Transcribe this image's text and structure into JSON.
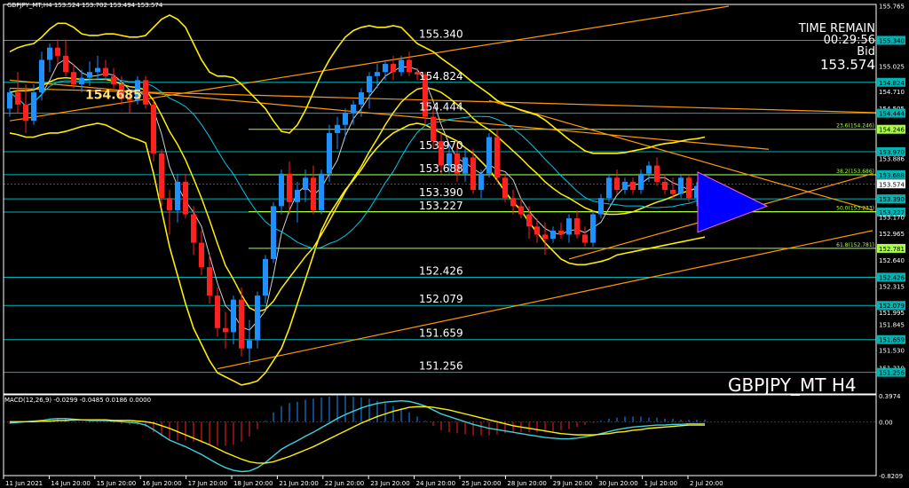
{
  "header": {
    "main_info": "GBPJPY_MT,H4  153.524 153.702 153.494 153.574",
    "macd_info": "MACD(12,26,9) -0.0299 -0.0485 0.0186 0.0000"
  },
  "info_panel": {
    "time_remain_label": "TIME REMAIN",
    "time_remain_value": "00:29:56",
    "bid_label": "Bid",
    "bid_value": "153.574"
  },
  "symbol_watermark": "GBPJPY_MT H4",
  "colors": {
    "background": "#000000",
    "bull_candle": "#1e90ff",
    "bear_candle": "#ff2020",
    "level_line": "#00b4b4",
    "fib_line": "#a8ff40",
    "bollinger": "#ffee00",
    "trend_line": "#ff9900",
    "ma_fast": "#d0d0d0",
    "ma_slow": "#00c8e8",
    "triangle": "#0000ff"
  },
  "chart_data": [
    {
      "type": "candlestick",
      "title": "GBPJPY_MT,H4",
      "ylim": [
        150.99,
        155.76
      ],
      "x_tick_labels": [
        "11 Jun 2021",
        "14 Jun 20:00",
        "15 Jun 20:00",
        "16 Jun 20:00",
        "17 Jun 20:00",
        "18 Jun 20:00",
        "21 Jun 20:00",
        "22 Jun 20:00",
        "23 Jun 20:00",
        "24 Jun 20:00",
        "25 Jun 20:00",
        "28 Jun 20:00",
        "29 Jun 20:00",
        "30 Jun 20:00",
        "1 Jul 20:00",
        "2 Jul 20:00"
      ],
      "y_tick_labels": [
        "155.765",
        "155.340",
        "155.025",
        "154.824",
        "154.710",
        "154.505",
        "154.444",
        "154.246",
        "153.970",
        "153.886",
        "153.688",
        "153.574",
        "153.390",
        "153.227",
        "153.170",
        "152.965",
        "152.781",
        "152.640",
        "152.426",
        "152.315",
        "152.079",
        "151.995",
        "151.845",
        "151.659",
        "151.530",
        "151.310",
        "151.256"
      ],
      "levels": [
        {
          "label": "155.340",
          "value": 155.34
        },
        {
          "label": "154.824",
          "value": 154.824
        },
        {
          "label": "154.444",
          "value": 154.444
        },
        {
          "label": "153.970",
          "value": 153.97
        },
        {
          "label": "153.688",
          "value": 153.688
        },
        {
          "label": "153.390",
          "value": 153.39
        },
        {
          "label": "153.227",
          "value": 153.227
        },
        {
          "label": "152.426",
          "value": 152.426
        },
        {
          "label": "152.079",
          "value": 152.079
        },
        {
          "label": "151.659",
          "value": 151.659
        },
        {
          "label": "151.256",
          "value": 151.256
        }
      ],
      "fib_labels": [
        {
          "label": "23.6(154.246)",
          "value": 154.246
        },
        {
          "label": "38.2(153.686)",
          "value": 153.686
        },
        {
          "label": "50.0(153.233)",
          "value": 153.233
        },
        {
          "label": "61.8(152.781)",
          "value": 152.781
        }
      ],
      "annotation": {
        "label": "154.685",
        "value": 154.685
      },
      "current_price": 153.574,
      "ohlc": [
        [
          154.5,
          154.75,
          154.4,
          154.7
        ],
        [
          154.7,
          154.95,
          154.45,
          154.55
        ],
        [
          154.55,
          154.8,
          154.2,
          154.35
        ],
        [
          154.35,
          154.8,
          154.3,
          154.7
        ],
        [
          154.7,
          155.2,
          154.6,
          155.1
        ],
        [
          155.1,
          155.3,
          154.95,
          155.25
        ],
        [
          155.25,
          155.35,
          155.05,
          155.15
        ],
        [
          155.15,
          155.35,
          154.9,
          154.95
        ],
        [
          154.95,
          155.05,
          154.75,
          154.8
        ],
        [
          154.8,
          154.98,
          154.7,
          154.88
        ],
        [
          154.88,
          155.08,
          154.78,
          154.95
        ],
        [
          154.95,
          155.15,
          154.85,
          155.0
        ],
        [
          155.0,
          155.1,
          154.85,
          154.9
        ],
        [
          154.9,
          155.0,
          154.75,
          154.8
        ],
        [
          154.8,
          154.9,
          154.55,
          154.62
        ],
        [
          154.62,
          154.72,
          154.45,
          154.6
        ],
        [
          154.6,
          154.9,
          154.55,
          154.85
        ],
        [
          154.85,
          154.9,
          154.5,
          154.55
        ],
        [
          154.55,
          154.6,
          153.85,
          153.95
        ],
        [
          153.95,
          154.0,
          153.3,
          153.4
        ],
        [
          153.4,
          153.5,
          152.95,
          153.25
        ],
        [
          153.25,
          153.7,
          153.1,
          153.6
        ],
        [
          153.6,
          153.7,
          153.15,
          153.2
        ],
        [
          153.2,
          153.3,
          152.7,
          152.85
        ],
        [
          152.85,
          153.0,
          152.45,
          152.55
        ],
        [
          152.55,
          152.7,
          152.1,
          152.2
        ],
        [
          152.2,
          152.3,
          151.7,
          151.8
        ],
        [
          151.8,
          152.0,
          151.55,
          151.75
        ],
        [
          151.75,
          152.2,
          151.6,
          152.15
        ],
        [
          152.15,
          152.3,
          151.45,
          151.55
        ],
        [
          151.55,
          151.9,
          151.35,
          151.65
        ],
        [
          151.65,
          152.25,
          151.55,
          152.2
        ],
        [
          152.2,
          152.7,
          152.1,
          152.65
        ],
        [
          152.65,
          153.35,
          152.6,
          153.3
        ],
        [
          153.3,
          153.75,
          153.2,
          153.7
        ],
        [
          153.7,
          153.85,
          153.2,
          153.35
        ],
        [
          153.35,
          153.6,
          153.1,
          153.5
        ],
        [
          153.5,
          153.75,
          153.35,
          153.65
        ],
        [
          153.65,
          153.8,
          153.2,
          153.25
        ],
        [
          153.25,
          153.75,
          153.2,
          153.7
        ],
        [
          153.7,
          154.3,
          153.6,
          154.2
        ],
        [
          154.2,
          154.4,
          154.0,
          154.3
        ],
        [
          154.3,
          154.5,
          154.15,
          154.45
        ],
        [
          154.45,
          154.6,
          154.3,
          154.55
        ],
        [
          154.55,
          154.75,
          154.4,
          154.7
        ],
        [
          154.7,
          154.95,
          154.5,
          154.9
        ],
        [
          154.9,
          155.05,
          154.75,
          154.95
        ],
        [
          154.95,
          155.1,
          154.85,
          155.05
        ],
        [
          155.05,
          155.15,
          154.85,
          154.95
        ],
        [
          154.95,
          155.15,
          154.9,
          155.1
        ],
        [
          155.1,
          155.2,
          154.9,
          154.95
        ],
        [
          154.95,
          155.0,
          154.85,
          154.92
        ],
        [
          154.92,
          154.95,
          154.3,
          154.4
        ],
        [
          154.4,
          154.5,
          154.0,
          154.1
        ],
        [
          154.1,
          154.2,
          153.7,
          153.8
        ],
        [
          153.8,
          154.05,
          153.7,
          153.95
        ],
        [
          153.95,
          154.1,
          153.6,
          153.7
        ],
        [
          153.7,
          154.0,
          153.6,
          153.9
        ],
        [
          153.9,
          154.0,
          153.45,
          153.5
        ],
        [
          153.5,
          153.75,
          153.4,
          153.7
        ],
        [
          153.7,
          154.2,
          153.65,
          154.15
        ],
        [
          154.15,
          154.25,
          153.6,
          153.65
        ],
        [
          153.65,
          153.7,
          153.35,
          153.4
        ],
        [
          153.4,
          153.5,
          153.2,
          153.3
        ],
        [
          153.3,
          153.4,
          153.15,
          153.2
        ],
        [
          153.2,
          153.3,
          152.9,
          153.05
        ],
        [
          153.05,
          153.15,
          152.85,
          152.95
        ],
        [
          152.95,
          153.1,
          152.7,
          152.9
        ],
        [
          152.9,
          153.05,
          152.85,
          153.0
        ],
        [
          153.0,
          153.1,
          152.9,
          152.95
        ],
        [
          152.95,
          153.2,
          152.85,
          153.15
        ],
        [
          153.15,
          153.25,
          152.9,
          152.95
        ],
        [
          152.95,
          153.05,
          152.8,
          152.85
        ],
        [
          152.85,
          153.25,
          152.8,
          153.2
        ],
        [
          153.2,
          153.45,
          153.15,
          153.4
        ],
        [
          153.4,
          153.7,
          153.35,
          153.65
        ],
        [
          153.65,
          153.75,
          153.45,
          153.5
        ],
        [
          153.5,
          153.65,
          153.45,
          153.6
        ],
        [
          153.6,
          153.65,
          153.45,
          153.5
        ],
        [
          153.5,
          153.75,
          153.45,
          153.7
        ],
        [
          153.7,
          153.85,
          153.6,
          153.8
        ],
        [
          153.8,
          153.9,
          153.55,
          153.6
        ],
        [
          153.6,
          153.7,
          153.45,
          153.5
        ],
        [
          153.5,
          153.65,
          153.4,
          153.45
        ],
        [
          153.45,
          153.7,
          153.4,
          153.65
        ],
        [
          153.65,
          153.7,
          153.35,
          153.4
        ],
        [
          153.4,
          153.6,
          153.3,
          153.55
        ],
        [
          153.55,
          153.7,
          153.5,
          153.574
        ]
      ],
      "bollinger": {
        "mid": [
          154.7,
          154.72,
          154.72,
          154.73,
          154.78,
          154.83,
          154.87,
          154.88,
          154.87,
          154.86,
          154.86,
          154.86,
          154.86,
          154.84,
          154.8,
          154.77,
          154.76,
          154.73,
          154.6,
          154.42,
          154.22,
          154.06,
          153.87,
          153.64,
          153.4,
          153.13,
          152.84,
          152.57,
          152.4,
          152.21,
          152.05,
          152.0,
          152.03,
          152.13,
          152.29,
          152.42,
          152.55,
          152.68,
          152.79,
          152.95,
          153.12,
          153.3,
          153.48,
          153.64,
          153.79,
          153.97,
          154.13,
          154.3,
          154.45,
          154.58,
          154.67,
          154.74,
          154.76,
          154.74,
          154.7,
          154.63,
          154.55,
          154.48,
          154.38,
          154.3,
          154.24,
          154.16,
          154.07,
          153.98,
          153.89,
          153.79,
          153.7,
          153.6,
          153.52,
          153.45,
          153.4,
          153.34,
          153.28,
          153.24,
          153.21,
          153.2,
          153.2,
          153.21,
          153.23,
          153.27,
          153.31,
          153.35,
          153.38,
          153.42,
          153.46,
          153.49,
          153.52,
          153.55
        ],
        "upper": [
          155.2,
          155.25,
          155.28,
          155.3,
          155.38,
          155.48,
          155.55,
          155.55,
          155.5,
          155.42,
          155.4,
          155.4,
          155.42,
          155.42,
          155.4,
          155.38,
          155.38,
          155.4,
          155.5,
          155.6,
          155.65,
          155.6,
          155.5,
          155.3,
          155.1,
          154.95,
          154.9,
          154.9,
          154.88,
          154.8,
          154.7,
          154.6,
          154.5,
          154.35,
          154.22,
          154.2,
          154.3,
          154.48,
          154.7,
          154.92,
          155.1,
          155.25,
          155.38,
          155.46,
          155.5,
          155.52,
          155.5,
          155.5,
          155.52,
          155.5,
          155.4,
          155.3,
          155.25,
          155.2,
          155.12,
          155.05,
          154.98,
          154.9,
          154.82,
          154.75,
          154.68,
          154.6,
          154.55,
          154.52,
          154.48,
          154.45,
          154.42,
          154.36,
          154.28,
          154.2,
          154.12,
          154.05,
          153.98,
          153.95,
          153.95,
          153.95,
          153.95,
          153.96,
          153.98,
          154.0,
          154.02,
          154.05,
          154.07,
          154.08,
          154.1,
          154.12,
          154.13,
          154.15
        ],
        "lower": [
          154.2,
          154.18,
          154.15,
          154.15,
          154.18,
          154.2,
          154.2,
          154.22,
          154.25,
          154.28,
          154.3,
          154.32,
          154.3,
          154.25,
          154.2,
          154.15,
          154.12,
          154.08,
          153.7,
          153.25,
          152.8,
          152.45,
          152.1,
          151.8,
          151.6,
          151.4,
          151.25,
          151.2,
          151.15,
          151.1,
          151.12,
          151.15,
          151.25,
          151.4,
          151.55,
          151.8,
          152.1,
          152.4,
          152.7,
          153.0,
          153.2,
          153.35,
          153.5,
          153.62,
          153.75,
          153.9,
          154.02,
          154.12,
          154.2,
          154.25,
          154.3,
          154.32,
          154.3,
          154.25,
          154.2,
          154.15,
          154.1,
          154.02,
          153.95,
          153.85,
          153.75,
          153.62,
          153.48,
          153.35,
          153.25,
          153.1,
          152.98,
          152.85,
          152.75,
          152.65,
          152.6,
          152.58,
          152.58,
          152.6,
          152.62,
          152.65,
          152.7,
          152.72,
          152.74,
          152.76,
          152.78,
          152.8,
          152.82,
          152.84,
          152.86,
          152.88,
          152.9,
          152.92
        ]
      }
    },
    {
      "type": "line",
      "title": "MACD(12,26,9) -0.0299 -0.0485 0.0186 0.0000",
      "ylim": [
        -0.8209,
        0.3974
      ],
      "y_tick_labels": [
        "0.3974",
        "0.00",
        "-0.8209"
      ],
      "series": [
        {
          "name": "MACD",
          "values": [
            -0.02,
            -0.01,
            0.0,
            0.01,
            0.02,
            0.04,
            0.05,
            0.05,
            0.04,
            0.03,
            0.02,
            0.02,
            0.02,
            0.01,
            0.0,
            -0.01,
            -0.02,
            -0.05,
            -0.12,
            -0.2,
            -0.28,
            -0.33,
            -0.38,
            -0.44,
            -0.5,
            -0.57,
            -0.64,
            -0.7,
            -0.74,
            -0.76,
            -0.75,
            -0.7,
            -0.62,
            -0.52,
            -0.42,
            -0.35,
            -0.29,
            -0.22,
            -0.16,
            -0.09,
            -0.02,
            0.05,
            0.11,
            0.16,
            0.21,
            0.25,
            0.28,
            0.3,
            0.31,
            0.32,
            0.31,
            0.28,
            0.24,
            0.18,
            0.12,
            0.08,
            0.04,
            0.0,
            -0.04,
            -0.07,
            -0.1,
            -0.12,
            -0.14,
            -0.16,
            -0.18,
            -0.2,
            -0.22,
            -0.24,
            -0.25,
            -0.26,
            -0.26,
            -0.25,
            -0.23,
            -0.21,
            -0.18,
            -0.15,
            -0.12,
            -0.1,
            -0.08,
            -0.07,
            -0.06,
            -0.05,
            -0.05,
            -0.04,
            -0.04,
            -0.03,
            -0.03,
            -0.03
          ]
        },
        {
          "name": "Signal",
          "values": [
            0.0,
            0.0,
            0.0,
            0.0,
            0.01,
            0.01,
            0.02,
            0.02,
            0.03,
            0.03,
            0.03,
            0.03,
            0.03,
            0.02,
            0.02,
            0.02,
            0.01,
            0.0,
            -0.02,
            -0.06,
            -0.1,
            -0.15,
            -0.2,
            -0.25,
            -0.3,
            -0.35,
            -0.41,
            -0.47,
            -0.52,
            -0.57,
            -0.61,
            -0.63,
            -0.63,
            -0.61,
            -0.57,
            -0.53,
            -0.48,
            -0.43,
            -0.38,
            -0.32,
            -0.26,
            -0.2,
            -0.14,
            -0.08,
            -0.02,
            0.03,
            0.08,
            0.12,
            0.16,
            0.19,
            0.22,
            0.23,
            0.23,
            0.22,
            0.2,
            0.18,
            0.15,
            0.12,
            0.09,
            0.06,
            0.03,
            0.0,
            -0.03,
            -0.06,
            -0.08,
            -0.1,
            -0.12,
            -0.14,
            -0.16,
            -0.18,
            -0.19,
            -0.2,
            -0.2,
            -0.2,
            -0.19,
            -0.18,
            -0.16,
            -0.15,
            -0.13,
            -0.12,
            -0.1,
            -0.09,
            -0.08,
            -0.07,
            -0.06,
            -0.05,
            -0.05,
            -0.05
          ]
        }
      ]
    }
  ]
}
